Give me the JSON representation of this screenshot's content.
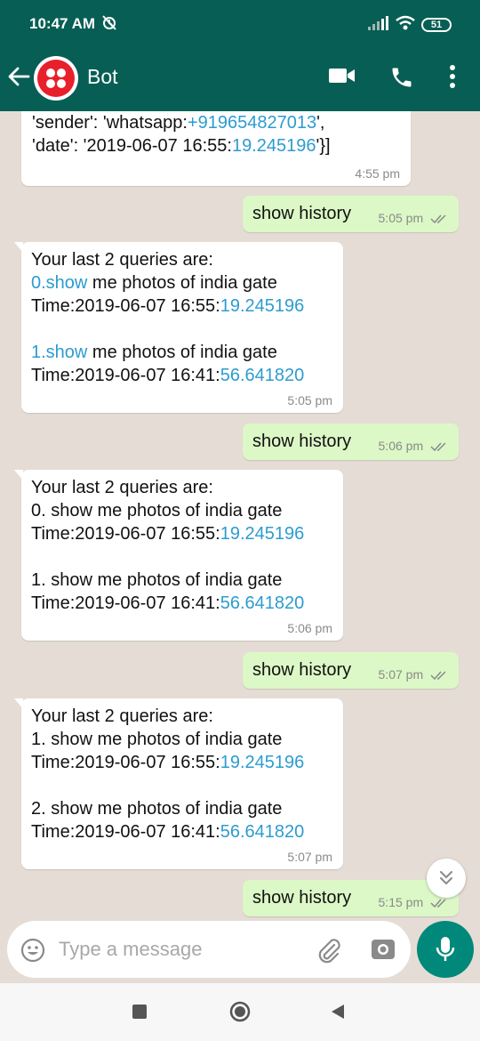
{
  "status_bar": {
    "time": "10:47 AM",
    "battery": "51"
  },
  "header": {
    "title": "Bot"
  },
  "messages": [
    {
      "dir": "in",
      "segments": [
        [
          {
            "t": "'sender': 'whatsapp:"
          },
          {
            "t": "+919654827013",
            "link": true
          },
          {
            "t": "',"
          }
        ],
        [
          {
            "t": "'date': '2019-06-07 16:55:"
          },
          {
            "t": "19.245196",
            "link": true
          },
          {
            "t": "'}]"
          }
        ]
      ],
      "time": "4:55 pm"
    },
    {
      "dir": "out",
      "text": "show history",
      "time": "5:05 pm"
    },
    {
      "dir": "in",
      "segments": [
        [
          {
            "t": "Your last 2 queries are:"
          }
        ],
        [
          {
            "t": "0.show",
            "link": true
          },
          {
            "t": " me photos of india gate"
          }
        ],
        [
          {
            "t": "Time:2019-06-07 16:55:"
          },
          {
            "t": "19.245196",
            "link": true
          }
        ],
        [],
        [
          {
            "t": "1.show",
            "link": true
          },
          {
            "t": " me photos of india gate"
          }
        ],
        [
          {
            "t": "Time:2019-06-07 16:41:"
          },
          {
            "t": "56.641820",
            "link": true
          }
        ]
      ],
      "time": "5:05 pm"
    },
    {
      "dir": "out",
      "text": "show history",
      "time": "5:06 pm"
    },
    {
      "dir": "in",
      "segments": [
        [
          {
            "t": "Your last 2 queries are:"
          }
        ],
        [
          {
            "t": "0. show me photos of india gate"
          }
        ],
        [
          {
            "t": "Time:2019-06-07 16:55:"
          },
          {
            "t": "19.245196",
            "link": true
          }
        ],
        [],
        [
          {
            "t": "1. show me photos of india gate"
          }
        ],
        [
          {
            "t": "Time:2019-06-07 16:41:"
          },
          {
            "t": "56.641820",
            "link": true
          }
        ]
      ],
      "time": "5:06 pm"
    },
    {
      "dir": "out",
      "text": "show history",
      "time": "5:07 pm"
    },
    {
      "dir": "in",
      "segments": [
        [
          {
            "t": "Your last 2 queries are:"
          }
        ],
        [
          {
            "t": "1. show me photos of india gate"
          }
        ],
        [
          {
            "t": "Time:2019-06-07 16:55:"
          },
          {
            "t": "19.245196",
            "link": true
          }
        ],
        [],
        [
          {
            "t": "2. show me photos of india gate"
          }
        ],
        [
          {
            "t": "Time:2019-06-07 16:41:"
          },
          {
            "t": "56.641820",
            "link": true
          }
        ]
      ],
      "time": "5:07 pm"
    },
    {
      "dir": "out",
      "text": "show history",
      "time": "5:15 pm"
    }
  ],
  "composer": {
    "placeholder": "Type a message"
  },
  "icons": {
    "back": "arrow-left-icon",
    "video": "video-call-icon",
    "call": "phone-icon",
    "more": "more-vertical-icon",
    "emoji": "emoji-icon",
    "attach": "paperclip-icon",
    "camera": "camera-icon",
    "mic": "microphone-icon",
    "scroll": "double-chevron-down-icon"
  },
  "colors": {
    "header": "#075e54",
    "outgoing_bubble": "#dcf8c6",
    "incoming_bubble": "#ffffff",
    "link": "#2d9ccf",
    "mic_button": "#00897b"
  }
}
